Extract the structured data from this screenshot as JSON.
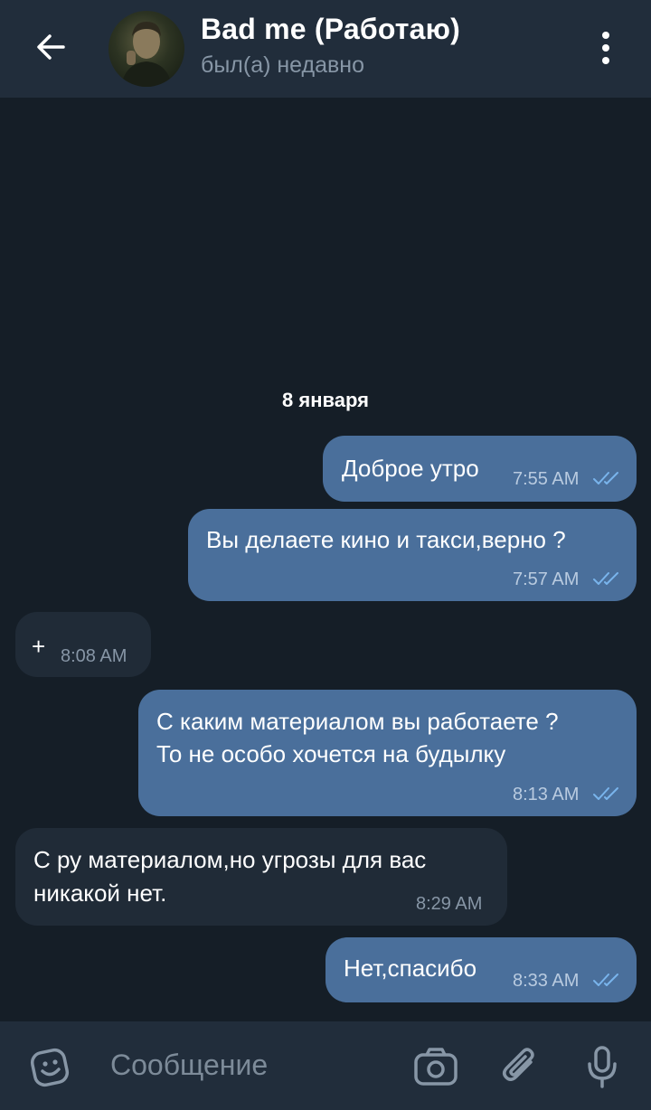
{
  "header": {
    "title": "Bad me (Работаю)",
    "status": "был(а) недавно",
    "back_icon": "arrow-left-icon",
    "menu_icon": "more-vertical-icon"
  },
  "date_divider": "8 января",
  "messages": [
    {
      "direction": "outgoing",
      "lines": [
        "Доброе утро"
      ],
      "time": "7:55 AM",
      "read": true
    },
    {
      "direction": "outgoing",
      "lines": [
        "Вы делаете кино и такси,верно ?"
      ],
      "time": "7:57 AM",
      "read": true
    },
    {
      "direction": "incoming",
      "lines": [
        "+"
      ],
      "time": "8:08 AM"
    },
    {
      "direction": "outgoing",
      "lines": [
        "С каким материалом вы работаете ?",
        "То не особо хочется на будылку"
      ],
      "time": "8:13 AM",
      "read": true
    },
    {
      "direction": "incoming",
      "lines": [
        "С ру материалом,но угрозы для вас",
        "никакой нет."
      ],
      "time": "8:29 AM"
    },
    {
      "direction": "outgoing",
      "lines": [
        "Нет,спасибо"
      ],
      "time": "8:33 AM",
      "read": true
    }
  ],
  "input": {
    "placeholder": "Сообщение",
    "icons": [
      "emoji-icon",
      "camera-icon",
      "attach-icon",
      "microphone-icon"
    ]
  },
  "colors": {
    "background": "#151e27",
    "header": "#212d3b",
    "outgoing_bubble": "#4a6f9b",
    "incoming_bubble": "#202b37",
    "read_ticks": "#79b4ec"
  }
}
